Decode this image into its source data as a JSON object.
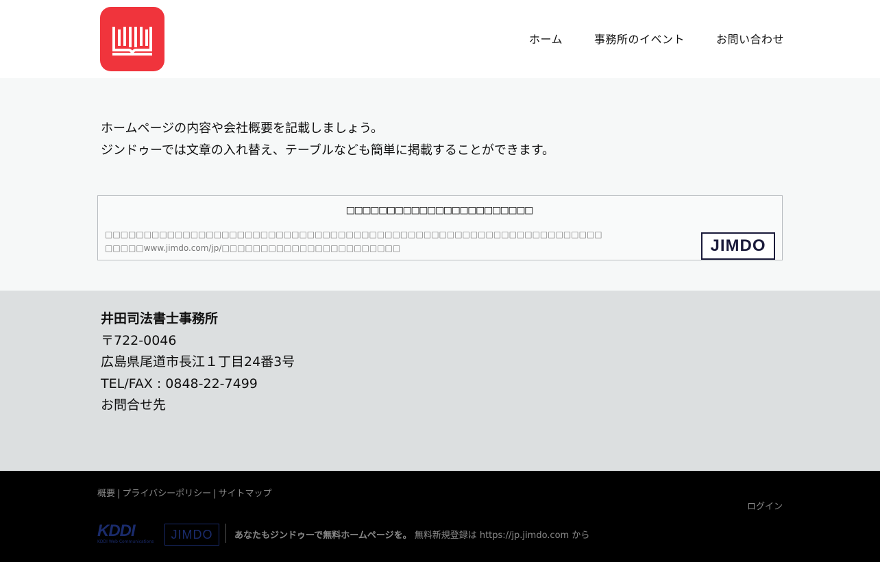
{
  "header": {
    "logo_icon": "open-book-icon",
    "nav": [
      {
        "label": "ホーム"
      },
      {
        "label": "事務所のイベント"
      },
      {
        "label": "お問い合わせ"
      }
    ]
  },
  "content": {
    "intro_lines": [
      "ホームページの内容や会社概要を記載しましょう。",
      "ジンドゥーでは文章の入れ替え、テーブルなども簡単に掲載することができます。"
    ],
    "notice": {
      "title": "□□□□□□□□□□□□□□□□□□□□□□□",
      "line1": "□□□□□□□□□□□□□□□□□□□□□□□□□□□□□□□□□□□□□□□□□□□□□□□□□□□□□□□□□□□□□□□□",
      "line2_prefix": "□□□□□",
      "line2_url": "www.jimdo.com/jp/",
      "line2_suffix": "□□□□□□□□□□□□□□□□□□□□□□□",
      "badge": "JIMDO"
    }
  },
  "address": {
    "company": "井田司法書士事務所",
    "postal": "〒722-0046",
    "street": "広島県尾道市長江１丁目24番3号",
    "tel": "TEL/FAX : 0848-22-7499",
    "contact": "お問合せ先"
  },
  "footer": {
    "links": [
      "概要",
      "プライバシーポリシー",
      "サイトマップ"
    ],
    "separator": "|",
    "login": "ログイン",
    "kddi_word": "KDDI",
    "kddi_sub": "KDDI Web Communications",
    "jimdo_small": "JIMDO",
    "promo_strong": "あなたもジンドゥーで無料ホームページを。",
    "promo_text": " 無料新規登録は https://jp.jimdo.com から"
  },
  "colors": {
    "logo_bg": "#f0343c",
    "content_bg": "#f6f8f8",
    "address_bg": "#dcdfe0",
    "footer_bg": "#000000"
  }
}
